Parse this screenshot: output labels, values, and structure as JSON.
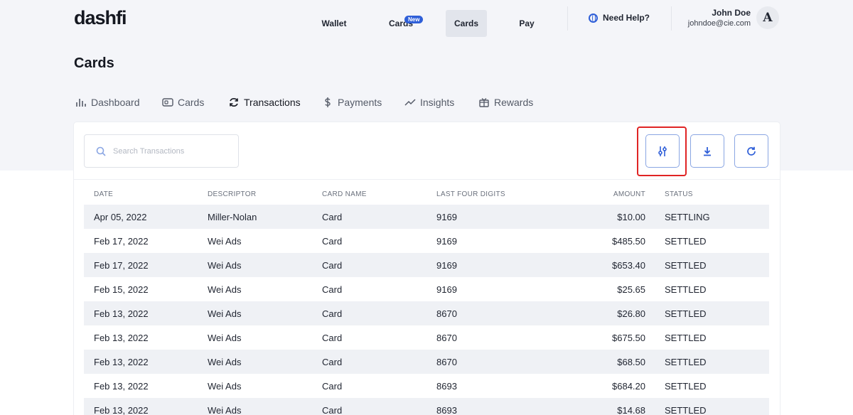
{
  "header": {
    "logo": "dashfi",
    "nav": [
      {
        "label": "Wallet",
        "badge": ""
      },
      {
        "label": "Cards",
        "badge": "New"
      },
      {
        "label": "Cards",
        "badge": "",
        "active": true
      },
      {
        "label": "Pay",
        "badge": ""
      }
    ],
    "help_label": "Need Help?",
    "user": {
      "name": "John Doe",
      "email": "johndoe@cie.com",
      "avatar_letter": "A"
    }
  },
  "page_title": "Cards",
  "subtabs": [
    {
      "label": "Dashboard",
      "icon": "bar-chart-icon"
    },
    {
      "label": "Cards",
      "icon": "card-icon"
    },
    {
      "label": "Transactions",
      "icon": "refresh-icon",
      "active": true
    },
    {
      "label": "Payments",
      "icon": "dollar-icon"
    },
    {
      "label": "Insights",
      "icon": "trend-icon"
    },
    {
      "label": "Rewards",
      "icon": "gift-icon"
    }
  ],
  "search": {
    "placeholder": "Search Transactions"
  },
  "toolbar": {
    "filter_icon": "filter-sliders-icon",
    "download_icon": "download-icon",
    "refresh_icon": "refresh-icon"
  },
  "table": {
    "headers": {
      "date": "DATE",
      "descriptor": "DESCRIPTOR",
      "card_name": "CARD NAME",
      "last_four": "LAST FOUR DIGITS",
      "amount": "AMOUNT",
      "status": "STATUS"
    },
    "rows": [
      {
        "date": "Apr 05, 2022",
        "descriptor": "Miller-Nolan",
        "card_name": "Card",
        "last_four": "9169",
        "amount": "$10.00",
        "status": "SETTLING"
      },
      {
        "date": "Feb 17, 2022",
        "descriptor": "Wei Ads",
        "card_name": "Card",
        "last_four": "9169",
        "amount": "$485.50",
        "status": "SETTLED"
      },
      {
        "date": "Feb 17, 2022",
        "descriptor": "Wei Ads",
        "card_name": "Card",
        "last_four": "9169",
        "amount": "$653.40",
        "status": "SETTLED"
      },
      {
        "date": "Feb 15, 2022",
        "descriptor": "Wei Ads",
        "card_name": "Card",
        "last_four": "9169",
        "amount": "$25.65",
        "status": "SETTLED"
      },
      {
        "date": "Feb 13, 2022",
        "descriptor": "Wei Ads",
        "card_name": "Card",
        "last_four": "8670",
        "amount": "$26.80",
        "status": "SETTLED"
      },
      {
        "date": "Feb 13, 2022",
        "descriptor": "Wei Ads",
        "card_name": "Card",
        "last_four": "8670",
        "amount": "$675.50",
        "status": "SETTLED"
      },
      {
        "date": "Feb 13, 2022",
        "descriptor": "Wei Ads",
        "card_name": "Card",
        "last_four": "8670",
        "amount": "$68.50",
        "status": "SETTLED"
      },
      {
        "date": "Feb 13, 2022",
        "descriptor": "Wei Ads",
        "card_name": "Card",
        "last_four": "8693",
        "amount": "$684.20",
        "status": "SETTLED"
      },
      {
        "date": "Feb 13, 2022",
        "descriptor": "Wei Ads",
        "card_name": "Card",
        "last_four": "8693",
        "amount": "$14.68",
        "status": "SETTLED"
      }
    ]
  },
  "colors": {
    "accent": "#2f5fd8",
    "highlight": "#e02424",
    "band": "#f4f5f9"
  }
}
